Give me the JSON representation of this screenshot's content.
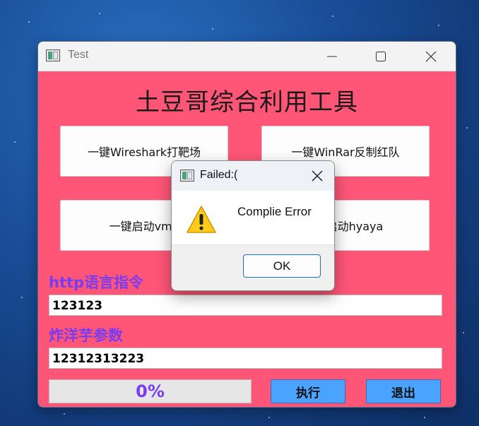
{
  "window": {
    "title": "Test",
    "heading": "土豆哥综合利用工具",
    "buttons": {
      "wireshark": "一键Wireshark打靶场",
      "winrar": "一键WinRar反制红队",
      "vmware": "一键启动vma",
      "hyaya": "启动hyaya"
    },
    "http_label": "http语言指令",
    "http_value": "123123",
    "param_label": "炸洋芋参数",
    "param_value": "12312313223",
    "progress_text": "0%",
    "progress_value": 0,
    "execute_label": "执行",
    "exit_label": "退出"
  },
  "dialog": {
    "title": "Failed:(",
    "message": "Complie Error",
    "ok_label": "OK"
  },
  "colors": {
    "client_bg": "#ff5577",
    "label_purple": "#7a3cf0",
    "action_blue": "#4aa3ff"
  },
  "icons": [
    "app-icon",
    "minimize-icon",
    "maximize-icon",
    "close-icon",
    "warning-icon"
  ]
}
